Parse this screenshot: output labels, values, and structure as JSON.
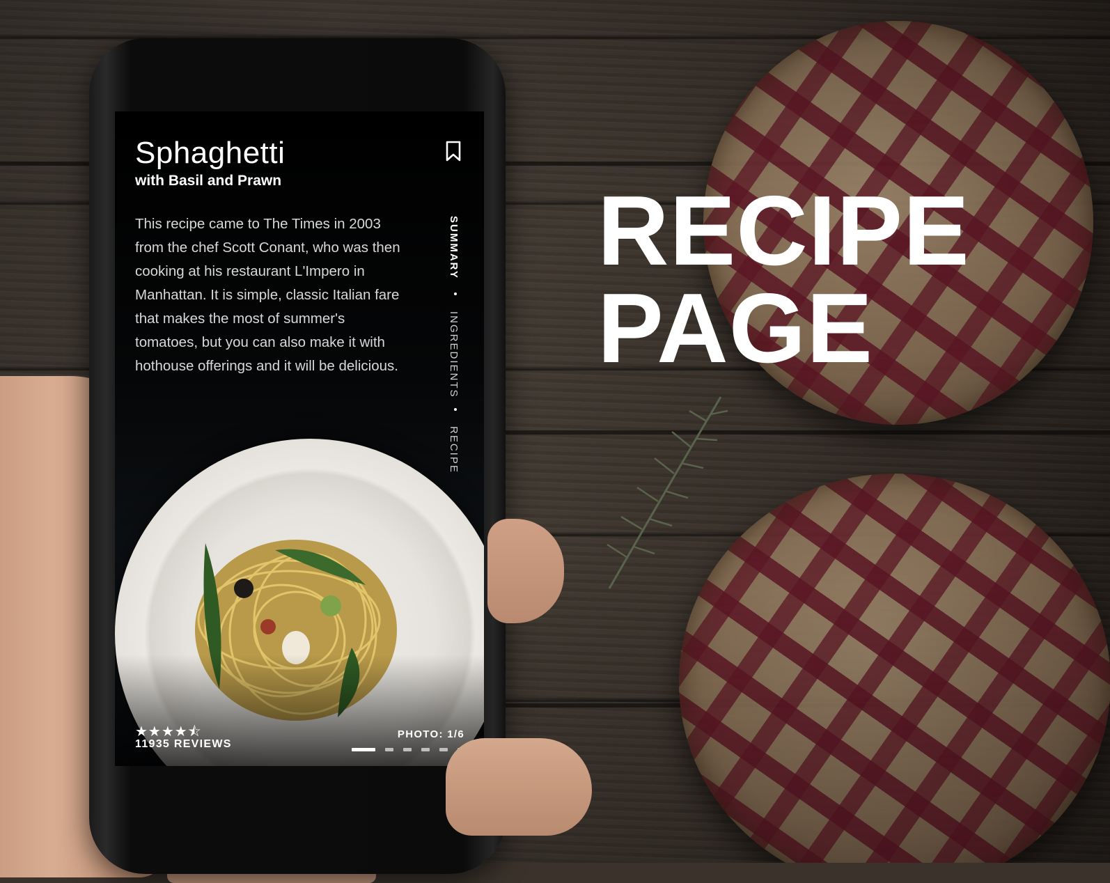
{
  "headline": {
    "line1": "RECIPE",
    "line2": "PAGE"
  },
  "recipe": {
    "title": "Sphaghetti",
    "subtitle": "with Basil and Prawn",
    "description": "This recipe came to The Times in 2003 from the chef Scott Conant, who was then cooking at his restaurant L'Impero in Manhattan. It is simple, classic Italian fare that makes the most of summer's tomatoes, but you can also make it with hothouse offerings and it will be delicious."
  },
  "nav": {
    "items": [
      {
        "label": "SUMMARY",
        "active": true
      },
      {
        "label": "INGREDIENTS",
        "active": false
      },
      {
        "label": "RECIPE",
        "active": false
      }
    ]
  },
  "rating": {
    "stars": "★★★★⯪",
    "value": 4.5,
    "max": 5,
    "reviews_label": "11935 REVIEWS"
  },
  "gallery": {
    "photo_label": "PHOTO: 1/6",
    "current": 1,
    "total": 6
  },
  "icons": {
    "bookmark": "bookmark-icon",
    "star": "star-icon"
  },
  "colors": {
    "screen_bg": "#000000",
    "text": "#ffffff",
    "muted_text": "#d8d8d8"
  }
}
